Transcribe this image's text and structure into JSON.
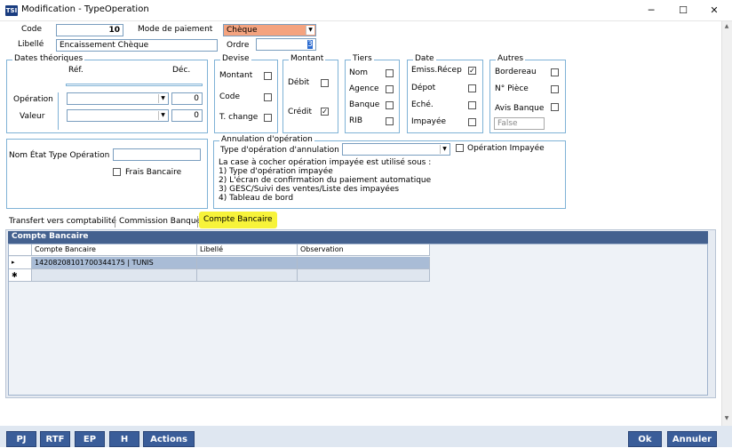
{
  "window": {
    "title": "Modification - TypeOperation",
    "icon_text": "TSI",
    "minimize": "─",
    "maximize": "☐",
    "close": "✕"
  },
  "header": {
    "code_label": "Code",
    "code_value": "10",
    "mode_label": "Mode de paiement",
    "mode_value": "Chèque",
    "libelle_label": "Libellé",
    "libelle_value": "Encaissement Chèque",
    "ordre_label": "Ordre",
    "ordre_value": "3"
  },
  "dates": {
    "title": "Dates théoriques",
    "ref_label": "Réf.",
    "dec_label": "Déc.",
    "operation_label": "Opération",
    "operation_dec": "0",
    "valeur_label": "Valeur",
    "valeur_dec": "0"
  },
  "devise": {
    "title": "Devise",
    "items": [
      "Montant",
      "Code",
      "T. change"
    ]
  },
  "montant": {
    "title": "Montant",
    "items": [
      {
        "label": "Débit",
        "checked": false
      },
      {
        "label": "Crédit",
        "checked": true
      }
    ]
  },
  "tiers": {
    "title": "Tiers",
    "items": [
      "Nom",
      "Agence",
      "Banque",
      "RIB"
    ]
  },
  "date": {
    "title": "Date",
    "items": [
      {
        "label": "Emiss.Récep",
        "checked": true
      },
      {
        "label": "Dépot",
        "checked": false
      },
      {
        "label": "Eché.",
        "checked": false
      },
      {
        "label": "Impayée",
        "checked": false
      }
    ]
  },
  "autres": {
    "title": "Autres",
    "items": [
      "Bordereau",
      "N° Pièce",
      "Avis Banque"
    ],
    "false_value": "False"
  },
  "etat": {
    "label": "Nom État Type Opération",
    "value": "",
    "frais_label": "Frais Bancaire"
  },
  "annulation": {
    "title": "Annulation d'opération",
    "type_label": "Type d'opération d'annulation",
    "type_value": "",
    "impayee_label": "Opération Impayée",
    "info_lines": [
      "La case à cocher opération impayée est utilisé sous :",
      "1) Type d'opération impayée",
      "2) L'écran de confirmation du paiement automatique",
      "3) GESC/Suivi des ventes/Liste des impayées",
      "4) Tableau de bord"
    ]
  },
  "tabs": [
    {
      "label": "Transfert vers comptabilité",
      "active": false
    },
    {
      "label": "Commission Banque",
      "active": false
    },
    {
      "label": "Compte Bancaire",
      "active": true
    }
  ],
  "grid": {
    "band_title": "Compte Bancaire",
    "columns": [
      "Compte Bancaire",
      "Libellé",
      "Observation"
    ],
    "rows": [
      [
        "14208208101700344175 | TUNIS",
        "",
        ""
      ]
    ],
    "current_marker": "▸",
    "new_marker": "✱"
  },
  "buttons": {
    "pj": "PJ",
    "rtf": "RTF",
    "ep": "EP",
    "h": "H",
    "actions": "Actions",
    "ok": "Ok",
    "annuler": "Annuler"
  },
  "colors": {
    "accent": "#3a5d99",
    "mode_field": "#f4a37f",
    "tab_highlight": "#f7f33a",
    "group_border": "#7fb2d6"
  }
}
